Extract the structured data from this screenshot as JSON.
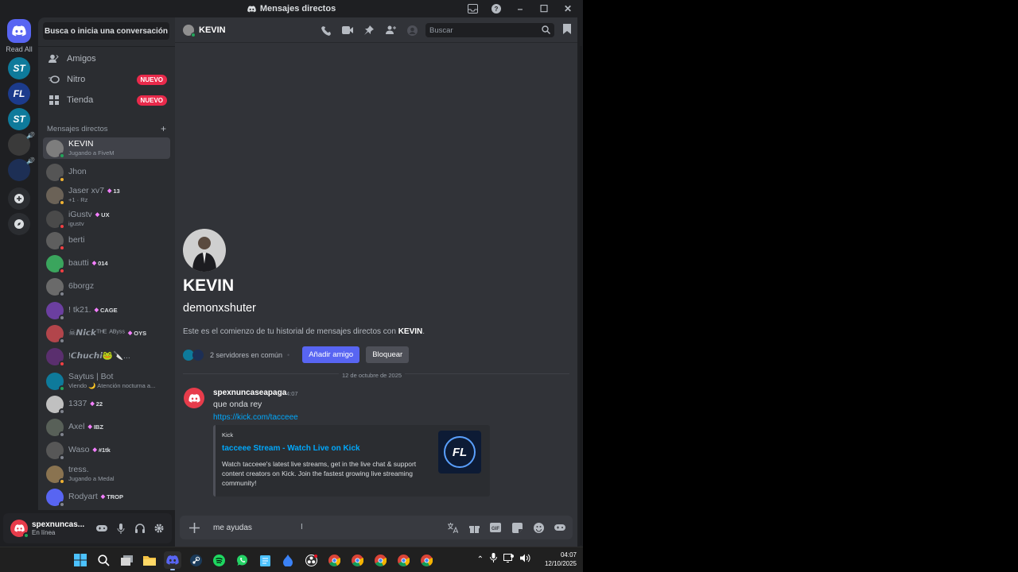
{
  "window": {
    "title": "Mensajes directos"
  },
  "rail": {
    "read_all": "Read All",
    "servers": [
      {
        "abbr": "ST",
        "color": "#0e7a9b"
      },
      {
        "abbr": "FL",
        "color": "#1c3b8c"
      },
      {
        "abbr": "ST",
        "color": "#0e7a9b"
      },
      {
        "abbr": "",
        "color": "#3a3a3a"
      },
      {
        "abbr": "",
        "color": "#1d2f55"
      }
    ]
  },
  "sidebar": {
    "search_label": "Busca o inicia una conversación",
    "nav": [
      {
        "label": "Amigos",
        "badge": ""
      },
      {
        "label": "Nitro",
        "badge": "NUEVO"
      },
      {
        "label": "Tienda",
        "badge": "NUEVO"
      }
    ],
    "dm_header": "Mensajes directos",
    "dms": [
      {
        "name": "KEVIN",
        "sub": "Jugando a FiveM",
        "tag": "",
        "status": "#23a55a",
        "avatar": "#7d7d7d",
        "active": true
      },
      {
        "name": "Jhon",
        "sub": "",
        "tag": "",
        "status": "#f0b232",
        "avatar": "#555555"
      },
      {
        "name": "Jaser xv7",
        "sub": "+1 · Rz",
        "tag": "13",
        "status": "#f0b232",
        "avatar": "#6b6257"
      },
      {
        "name": "iGustv",
        "sub": "igustv",
        "tag": "UX",
        "status": "#f23f43",
        "avatar": "#4a4a4a"
      },
      {
        "name": "berti",
        "sub": "",
        "tag": "",
        "status": "#f23f43",
        "avatar": "#5e5e5e"
      },
      {
        "name": "bautti",
        "sub": "",
        "tag": "014",
        "status": "#f23f43",
        "avatar": "#3aa55d"
      },
      {
        "name": "6borgz",
        "sub": "",
        "tag": "",
        "status": "#80848e",
        "avatar": "#6a6a6a"
      },
      {
        "name": "!         tk21.",
        "sub": "",
        "tag": "CAGE",
        "status": "#80848e",
        "avatar": "#6b3fa0"
      },
      {
        "name": "☠𝙉𝙞𝙘𝙠ᵀᴴᴱ ᴬᴮʸˢˢ",
        "sub": "",
        "tag": "OYS",
        "status": "#80848e",
        "avatar": "#b2454b"
      },
      {
        "name": "!𝘾𝙝𝙪𝙘𝙝𝙞🐸🔪...",
        "sub": "",
        "tag": "",
        "status": "#f23f43",
        "avatar": "#5a2f6e"
      },
      {
        "name": "Saytus | Bot",
        "sub": "Viendo 🌙 Atención nocturna a...",
        "tag": "",
        "status": "#23a55a",
        "avatar": "#0e7a9b"
      },
      {
        "name": "1337",
        "sub": "",
        "tag": "22",
        "status": "#80848e",
        "avatar": "#c0c0c0"
      },
      {
        "name": "Axel",
        "sub": "",
        "tag": "IBZ",
        "status": "#80848e",
        "avatar": "#586058"
      },
      {
        "name": "Waso",
        "sub": "",
        "tag": "#1tk",
        "status": "#80848e",
        "avatar": "#575757"
      },
      {
        "name": "tress.",
        "sub": "Jugando a Medal",
        "tag": "",
        "status": "#f0b232",
        "avatar": "#8a7350"
      },
      {
        "name": "Rodyart",
        "sub": "",
        "tag": "TROP",
        "status": "#80848e",
        "avatar": "#5865f2"
      }
    ]
  },
  "user_panel": {
    "name": "spexnuncas...",
    "status": "En línea"
  },
  "chat": {
    "header_name": "KEVIN",
    "search_placeholder": "Buscar",
    "welcome": {
      "display_name": "KEVIN",
      "username": "demonxshuter",
      "intro_prefix": "Este es el comienzo de tu historial de mensajes directos con ",
      "intro_name": "KEVIN",
      "intro_suffix": ".",
      "mutual_servers": "2 servidores en común",
      "add_friend": "Añadir amigo",
      "block": "Bloquear"
    },
    "date_divider": "12 de octubre de 2025",
    "message": {
      "author": "spexnuncaseapaga",
      "time": "4:07",
      "text": "que onda rey",
      "link": "https://kick.com/tacceee",
      "embed": {
        "provider": "Kick",
        "title": "tacceee Stream - Watch Live on Kick",
        "description": "Watch tacceee's latest live streams, get in the live chat & support content creators on Kick. Join the fastest growing live streaming community!",
        "thumb_text": "FL"
      }
    },
    "composer_value": "me ayudas"
  },
  "taskbar": {
    "time": "04:07",
    "date": "12/10/2025"
  },
  "colors": {
    "accent": "#5865f2",
    "online": "#23a55a",
    "danger": "#e92a4b",
    "link": "#00a8fc"
  }
}
